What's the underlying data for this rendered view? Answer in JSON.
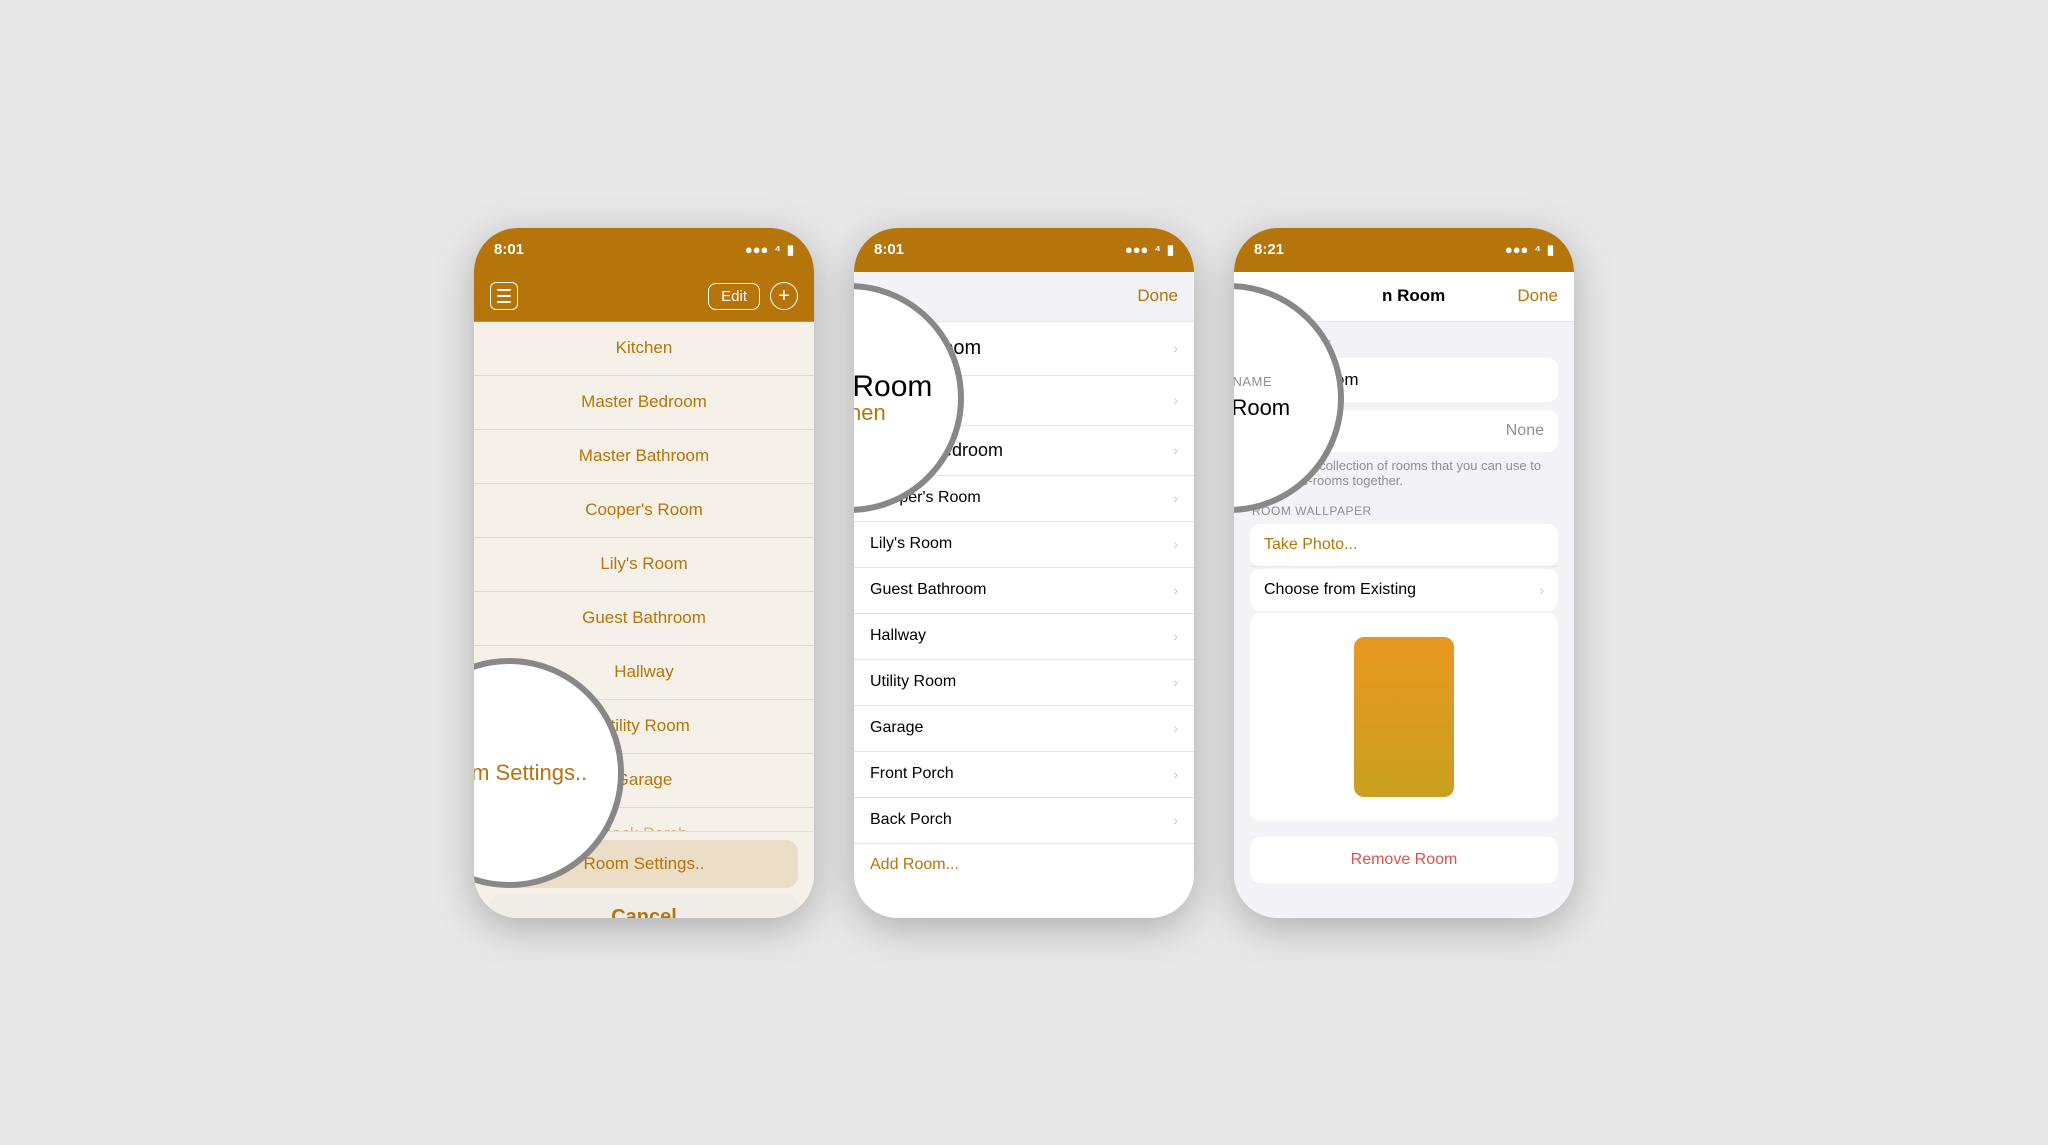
{
  "phone1": {
    "status": {
      "time": "8:01",
      "signal": "▌▌▌",
      "wifi": "WiFi",
      "battery": "🔋"
    },
    "nav": {
      "edit_label": "Edit",
      "add_label": "+"
    },
    "rooms": [
      {
        "name": "Kitchen"
      },
      {
        "name": "Master Bedroom"
      },
      {
        "name": "Master Bathroom"
      },
      {
        "name": "Cooper's Room"
      },
      {
        "name": "Lily's Room"
      },
      {
        "name": "Guest Bathroom"
      },
      {
        "name": "Hallway"
      },
      {
        "name": "Utility Room"
      },
      {
        "name": "Garage"
      },
      {
        "name": "Back Porch"
      }
    ],
    "magnifier": {
      "main_text": "Room Settings..",
      "label": "Room Settings.."
    },
    "cancel_label": "Cancel"
  },
  "phone2": {
    "status": {
      "time": "8:01"
    },
    "nav": {
      "done_label": "Done"
    },
    "magnifier": {
      "line1": "Living Room",
      "line2": "Kitchen"
    },
    "rooms": [
      {
        "name": "Living Room"
      },
      {
        "name": "Kitchen"
      },
      {
        "name": "Master Bedroom"
      },
      {
        "name": "Cooper's Room"
      },
      {
        "name": "Lily's Room"
      },
      {
        "name": "Guest Bathroom"
      },
      {
        "name": "Hallway"
      },
      {
        "name": "Utility Room"
      },
      {
        "name": "Garage"
      },
      {
        "name": "Front Porch"
      },
      {
        "name": "Back Porch"
      }
    ],
    "add_room_label": "Add Room..."
  },
  "phone3": {
    "status": {
      "time": "8:21"
    },
    "nav": {
      "title": "n Room",
      "done_label": "Done"
    },
    "magnifier": {
      "label": "ROOM NAME",
      "value": "Living Room"
    },
    "room_name_label": "ROOM NAME",
    "room_name_value": "Living Room",
    "zone_label": "None",
    "zone_desc": "A zone is a collection of rooms that you can use to group like-rooms together.",
    "wallpaper_label": "ROOM WALLPAPER",
    "take_photo_label": "Take Photo...",
    "choose_existing_label": "Choose from Existing",
    "remove_room_label": "Remove Room"
  },
  "icons": {
    "chevron": "›",
    "hamburger": "≡",
    "signal_bars": "●●●",
    "wifi": "WiFi",
    "battery": "▮"
  }
}
